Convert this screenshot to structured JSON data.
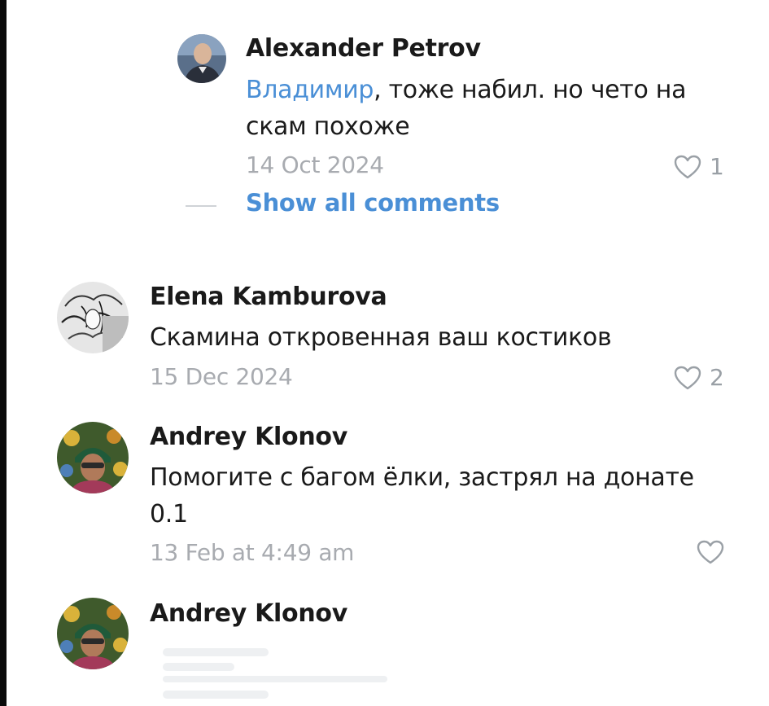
{
  "comments": [
    {
      "author": "Alexander Petrov",
      "mention": "Владимир",
      "text_line1": ", тоже набил. но чето на",
      "text_line2": "скам похоже",
      "date": "14 Oct 2024",
      "likes": "1"
    },
    {
      "author": "Elena Kamburova",
      "text": "Скамина откровенная ваш костиков",
      "date": "15 Dec 2024",
      "likes": "2"
    },
    {
      "author": "Andrey Klonov",
      "text_line1": "Помогите с багом ёлки, застрял на донате",
      "text_line2": "0.1",
      "date": "13 Feb at 4:49 am",
      "likes": ""
    },
    {
      "author": "Andrey Klonov"
    }
  ],
  "show_all_label": "Show all comments",
  "colors": {
    "accent": "#4a8fd6",
    "muted": "#a8abb0",
    "text": "#1a1a1a"
  }
}
